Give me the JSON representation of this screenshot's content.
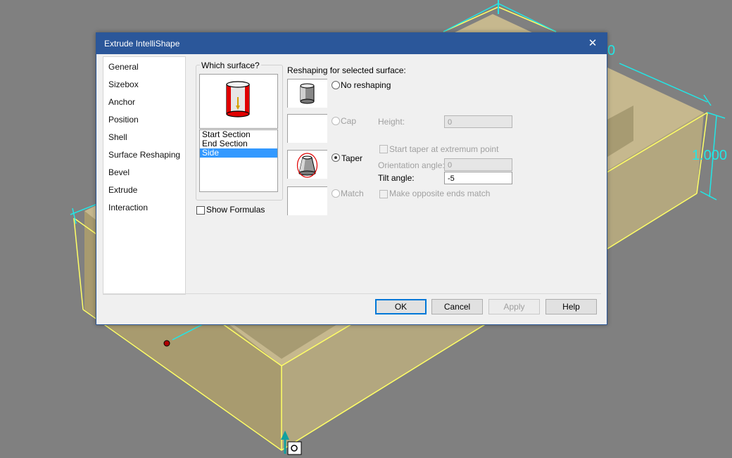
{
  "viewport": {
    "dimension_top_right": "1.000",
    "dimension_top_partial": "0"
  },
  "dialog": {
    "title": "Extrude IntelliShape",
    "close_symbol": "✕",
    "nav": [
      {
        "label": "General"
      },
      {
        "label": "Sizebox"
      },
      {
        "label": "Anchor"
      },
      {
        "label": "Position"
      },
      {
        "label": "Shell"
      },
      {
        "label": "Surface Reshaping"
      },
      {
        "label": "Bevel"
      },
      {
        "label": "Extrude"
      },
      {
        "label": "Interaction"
      }
    ],
    "which_surface": {
      "label": "Which surface?",
      "items": [
        "Start Section",
        "End Section",
        "Side"
      ],
      "selected": "Side"
    },
    "show_formulas": {
      "label": "Show Formulas",
      "checked": false
    },
    "reshaping": {
      "title": "Reshaping for selected surface:",
      "options": {
        "no_reshaping": "No reshaping",
        "cap": "Cap",
        "taper": "Taper",
        "match": "Match"
      },
      "selected": "Taper",
      "height_label": "Height:",
      "height_value": "0",
      "start_taper_label": "Start taper at extremum point",
      "orientation_label": "Orientation angle:",
      "orientation_value": "0",
      "tilt_label": "Tilt angle:",
      "tilt_value": "-5",
      "make_opposite_label": "Make opposite ends match"
    },
    "buttons": {
      "ok": "OK",
      "cancel": "Cancel",
      "apply": "Apply",
      "help": "Help"
    }
  },
  "colors": {
    "title_bar": "#2b579a",
    "selection": "#3399ff",
    "highlight_edge": "#ffff66",
    "dimension": "#22e6e6",
    "shape_fill": "#b3a77f"
  },
  "icons": [
    "cylinder-preview-icon",
    "close-icon",
    "cylinder-icon",
    "taper-cone-icon",
    "anchor-handle-icon",
    "move-handle-icon"
  ]
}
